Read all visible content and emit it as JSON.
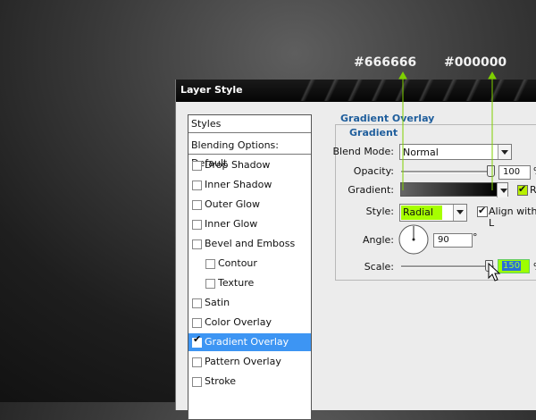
{
  "annotations": {
    "left": "#666666",
    "right": "#000000"
  },
  "colors": {
    "gradient_start": "#666666",
    "gradient_end": "#000000",
    "highlight": "#9dff00",
    "accent": "#3d95f3"
  },
  "dialog": {
    "title": "Layer Style"
  },
  "styles_panel": {
    "header": "Styles",
    "blending": "Blending Options: Default",
    "items": [
      {
        "label": "Drop Shadow",
        "checked": false,
        "selected": false,
        "indent": false
      },
      {
        "label": "Inner Shadow",
        "checked": false,
        "selected": false,
        "indent": false
      },
      {
        "label": "Outer Glow",
        "checked": false,
        "selected": false,
        "indent": false
      },
      {
        "label": "Inner Glow",
        "checked": false,
        "selected": false,
        "indent": false
      },
      {
        "label": "Bevel and Emboss",
        "checked": false,
        "selected": false,
        "indent": false
      },
      {
        "label": "Contour",
        "checked": false,
        "selected": false,
        "indent": true
      },
      {
        "label": "Texture",
        "checked": false,
        "selected": false,
        "indent": true
      },
      {
        "label": "Satin",
        "checked": false,
        "selected": false,
        "indent": false
      },
      {
        "label": "Color Overlay",
        "checked": false,
        "selected": false,
        "indent": false
      },
      {
        "label": "Gradient Overlay",
        "checked": true,
        "selected": true,
        "indent": false
      },
      {
        "label": "Pattern Overlay",
        "checked": false,
        "selected": false,
        "indent": false
      },
      {
        "label": "Stroke",
        "checked": false,
        "selected": false,
        "indent": false
      }
    ]
  },
  "gradient_overlay": {
    "section_title": "Gradient Overlay",
    "group_title": "Gradient",
    "blend_mode_label": "Blend Mode:",
    "blend_mode": "Normal",
    "opacity_label": "Opacity:",
    "opacity": "100",
    "opacity_level": 1.0,
    "percent": "%",
    "gradient_label": "Gradient:",
    "reverse_label": "Re",
    "reverse_checked": true,
    "style_label": "Style:",
    "style": "Radial",
    "align_label": "Align with L",
    "align_checked": true,
    "angle_label": "Angle:",
    "angle": "90",
    "degree": "°",
    "scale_label": "Scale:",
    "scale": "150",
    "scale_level": 1.0
  }
}
